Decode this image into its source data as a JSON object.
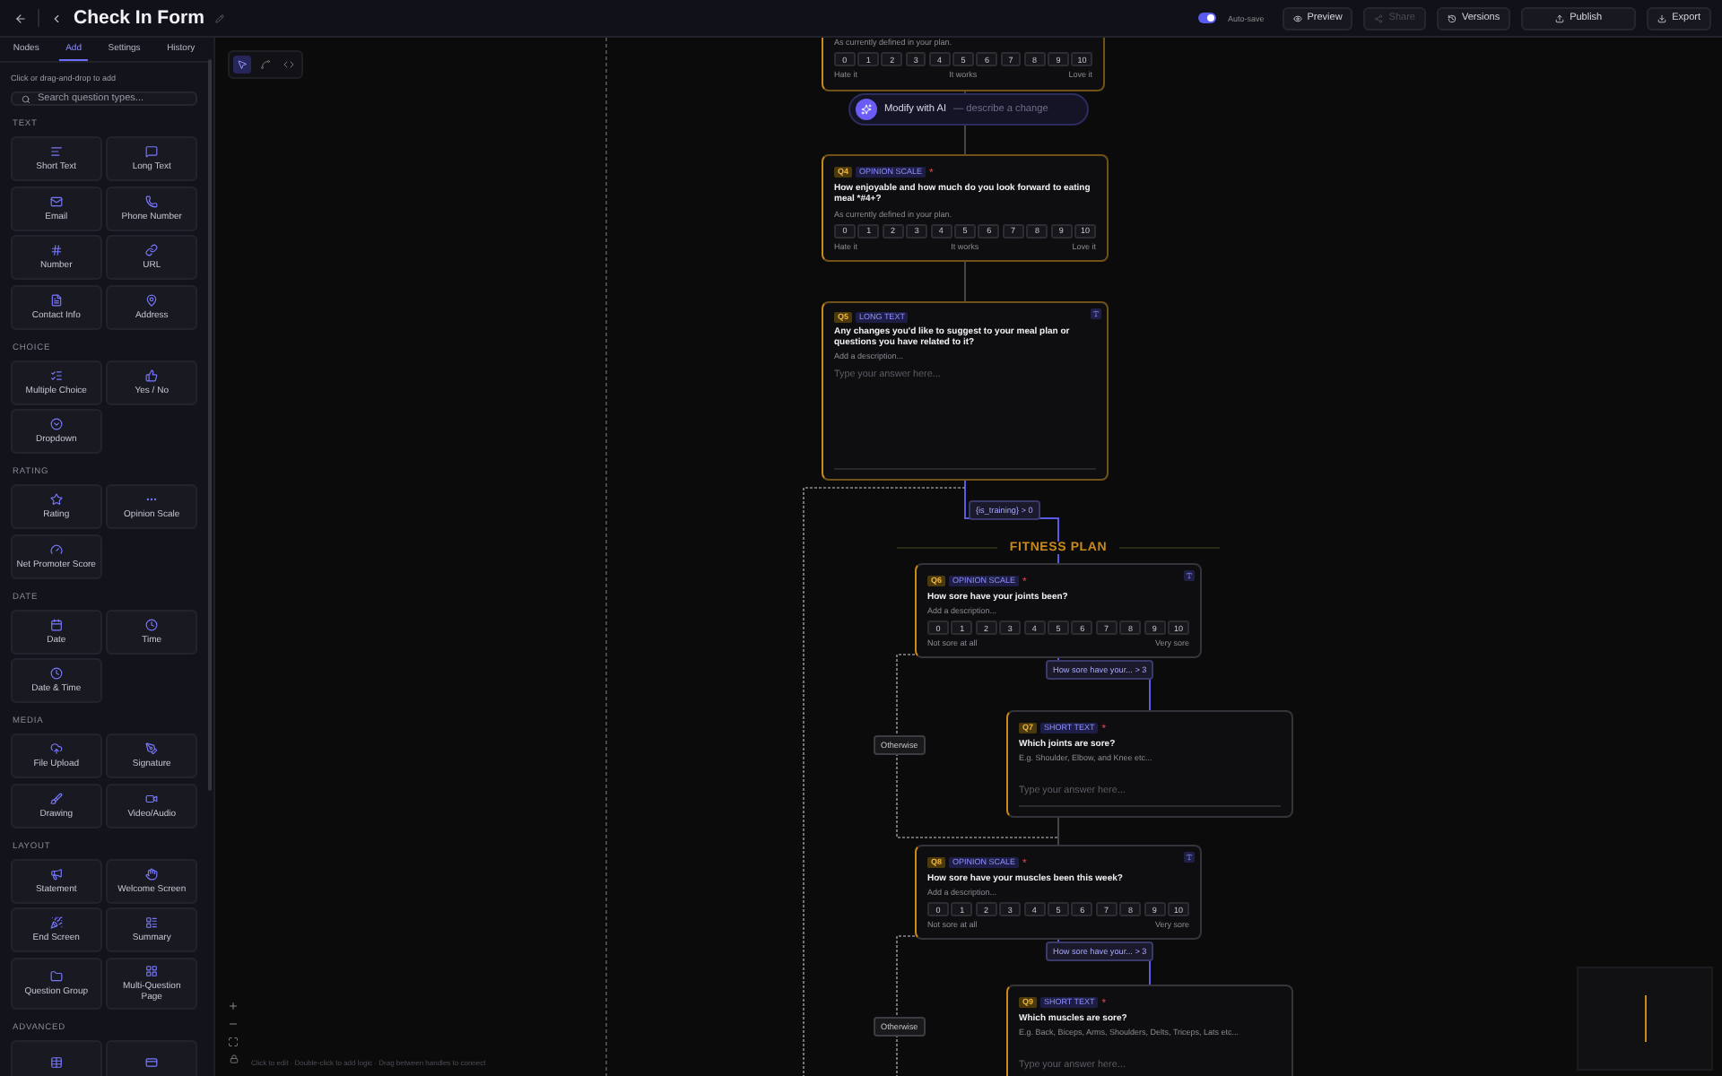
{
  "top_bar": {
    "title": "Check In Form",
    "autosave": {
      "label": "Auto-save",
      "on": true
    },
    "buttons": [
      {
        "label": "Preview",
        "kind": "preview",
        "disabled": false
      },
      {
        "label": "Share",
        "kind": "share",
        "disabled": true
      },
      {
        "label": "Versions",
        "kind": "versions",
        "disabled": false
      },
      {
        "label": "Publish",
        "kind": "publish",
        "disabled": false
      },
      {
        "label": "Export",
        "kind": "export",
        "disabled": false
      }
    ]
  },
  "sidebar": {
    "tabs": [
      {
        "label": "Nodes",
        "selected": false
      },
      {
        "label": "Add",
        "selected": true
      },
      {
        "label": "Settings",
        "selected": false
      },
      {
        "label": "History",
        "selected": false
      }
    ],
    "hint": "Click or drag-and-drop to add",
    "search": {
      "placeholder": "Search question types..."
    },
    "sections": [
      {
        "title": "TEXT",
        "items": [
          {
            "label": "Short Text",
            "kind": "short_text"
          },
          {
            "label": "Long Text",
            "kind": "long_text"
          },
          {
            "label": "Email",
            "kind": "email"
          },
          {
            "label": "Phone Number",
            "kind": "phone"
          },
          {
            "label": "Number",
            "kind": "number"
          },
          {
            "label": "URL",
            "kind": "url"
          },
          {
            "label": "Contact Info",
            "kind": "contact"
          },
          {
            "label": "Address",
            "kind": "address"
          }
        ]
      },
      {
        "title": "CHOICE",
        "items": [
          {
            "label": "Multiple Choice",
            "kind": "multiple_choice"
          },
          {
            "label": "Yes / No",
            "kind": "yes_no"
          },
          {
            "label": "Dropdown",
            "kind": "dropdown"
          }
        ]
      },
      {
        "title": "RATING",
        "items": [
          {
            "label": "Rating",
            "kind": "rating"
          },
          {
            "label": "Opinion Scale",
            "kind": "opinion_scale"
          },
          {
            "label": "Net Promoter Score",
            "kind": "nps"
          }
        ]
      },
      {
        "title": "DATE",
        "items": [
          {
            "label": "Date",
            "kind": "date"
          },
          {
            "label": "Time",
            "kind": "time"
          },
          {
            "label": "Date & Time",
            "kind": "datetime"
          }
        ]
      },
      {
        "title": "MEDIA",
        "items": [
          {
            "label": "File Upload",
            "kind": "upload"
          },
          {
            "label": "Signature",
            "kind": "signature"
          },
          {
            "label": "Drawing",
            "kind": "drawing"
          },
          {
            "label": "Video/Audio",
            "kind": "video"
          }
        ]
      },
      {
        "title": "LAYOUT",
        "items": [
          {
            "label": "Statement",
            "kind": "statement"
          },
          {
            "label": "Welcome Screen",
            "kind": "welcome"
          },
          {
            "label": "End Screen",
            "kind": "end"
          },
          {
            "label": "Summary",
            "kind": "summary"
          },
          {
            "label": "Question Group",
            "kind": "group"
          },
          {
            "label": "Multi-Question Page",
            "kind": "multi_page"
          }
        ]
      },
      {
        "title": "ADVANCED",
        "items": [
          {
            "kind": "matrix"
          },
          {
            "kind": "payment"
          }
        ]
      }
    ]
  },
  "canvas": {
    "tools": [
      {
        "selected": true
      },
      {
        "selected": false
      },
      {
        "selected": false
      }
    ],
    "ai_prompt": {
      "label": "Modify with AI",
      "hint": "— describe a change"
    },
    "section_label": "FITNESS PLAN",
    "nodes": [
      {
        "kind": "scale",
        "highlighted": true,
        "description": "As currently defined in your plan.",
        "options": [
          "0",
          "1",
          "2",
          "3",
          "4",
          "5",
          "6",
          "7",
          "8",
          "9",
          "10"
        ],
        "scale_labels": [
          "Hate it",
          "It works",
          "Love it"
        ]
      },
      {
        "kind": "scale",
        "highlighted": true,
        "badge": "Q4",
        "type_label": "OPINION SCALE",
        "required_mark": "*",
        "question": "How enjoyable and how much do you look forward to eating meal *#4+?",
        "description": "As currently defined in your plan.",
        "options": [
          "0",
          "1",
          "2",
          "3",
          "4",
          "5",
          "6",
          "7",
          "8",
          "9",
          "10"
        ],
        "scale_labels": [
          "Hate it",
          "It works",
          "Love it"
        ]
      },
      {
        "kind": "long_text",
        "highlighted": true,
        "action_button": true,
        "badge": "Q5",
        "type_label": "LONG TEXT",
        "question": "Any changes you'd like to suggest to your meal plan or questions you have related to it?",
        "description": "Add a description...",
        "placeholder": "Type your answer here..."
      },
      {
        "kind": "scale",
        "highlighted": false,
        "action_button": true,
        "badge": "Q6",
        "type_label": "OPINION SCALE",
        "required_mark": "*",
        "question": "How sore have your joints been?",
        "description": "Add a description...",
        "options": [
          "0",
          "1",
          "2",
          "3",
          "4",
          "5",
          "6",
          "7",
          "8",
          "9",
          "10"
        ],
        "scale_labels": [
          "Not sore at all",
          "Very sore"
        ]
      },
      {
        "kind": "short_text",
        "highlighted": false,
        "badge": "Q7",
        "type_label": "SHORT TEXT",
        "required_mark": "*",
        "question": "Which joints are sore?",
        "description": "E.g. Shoulder, Elbow, and Knee etc...",
        "placeholder": "Type your answer here..."
      },
      {
        "kind": "scale",
        "highlighted": false,
        "action_button": true,
        "badge": "Q8",
        "type_label": "OPINION SCALE",
        "required_mark": "*",
        "question": "How sore have your muscles been this week?",
        "description": "Add a description...",
        "options": [
          "0",
          "1",
          "2",
          "3",
          "4",
          "5",
          "6",
          "7",
          "8",
          "9",
          "10"
        ],
        "scale_labels": [
          "Not sore at all",
          "Very sore"
        ]
      },
      {
        "kind": "short_text",
        "highlighted": false,
        "badge": "Q9",
        "type_label": "SHORT TEXT",
        "required_mark": "*",
        "question": "Which muscles are sore?",
        "description": "E.g. Back, Biceps, Arms, Shoulders, Delts, Triceps, Lats etc...",
        "placeholder": "Type your answer here..."
      }
    ],
    "edge_labels": [
      {
        "label": "{is_training} > 0",
        "kind": "condition"
      },
      {
        "label": "How sore have your... > 3",
        "kind": "condition"
      },
      {
        "label": "Otherwise",
        "kind": "otherwise"
      },
      {
        "label": "How sore have your... > 3",
        "kind": "condition"
      },
      {
        "label": "Otherwise",
        "kind": "otherwise"
      }
    ],
    "footer_hint": "Click to edit · Double-click to add logic · Drag between handles to connect"
  }
}
